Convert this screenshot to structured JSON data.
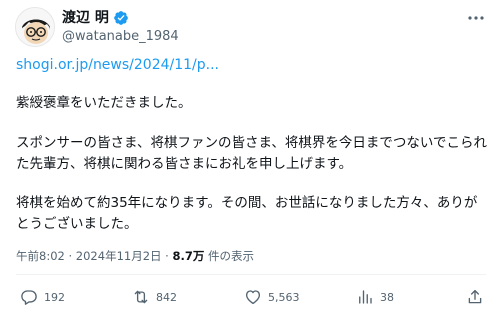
{
  "author": {
    "display_name": "渡辺 明",
    "handle": "@watanabe_1984"
  },
  "post": {
    "link_text": "shogi.or.jp/news/2024/11/p...",
    "paragraphs": [
      "紫綬褒章をいただきました。",
      "スポンサーの皆さま、将棋ファンの皆さま、将棋界を今日までつないでこられた先輩方、将棋に関わる皆さまにお礼を申し上げます。",
      "将棋を始めて約35年になります。その間、お世話になりました方々、ありがとうございました。"
    ]
  },
  "meta": {
    "time": "午前8:02",
    "separator": "·",
    "date": "2024年11月2日",
    "views_count": "8.7万",
    "views_label": "件の表示"
  },
  "actions": {
    "reply_count": "192",
    "repost_count": "842",
    "like_count": "5,563",
    "bookmark_count": "38"
  },
  "colors": {
    "accent": "#1d9bf0",
    "text": "#0f1419",
    "muted": "#536471"
  },
  "icons": {
    "verified": "verified-badge-icon",
    "more": "more-dots-icon",
    "reply": "reply-icon",
    "repost": "repost-icon",
    "like": "heart-icon",
    "views": "bar-chart-icon",
    "share": "share-icon"
  }
}
